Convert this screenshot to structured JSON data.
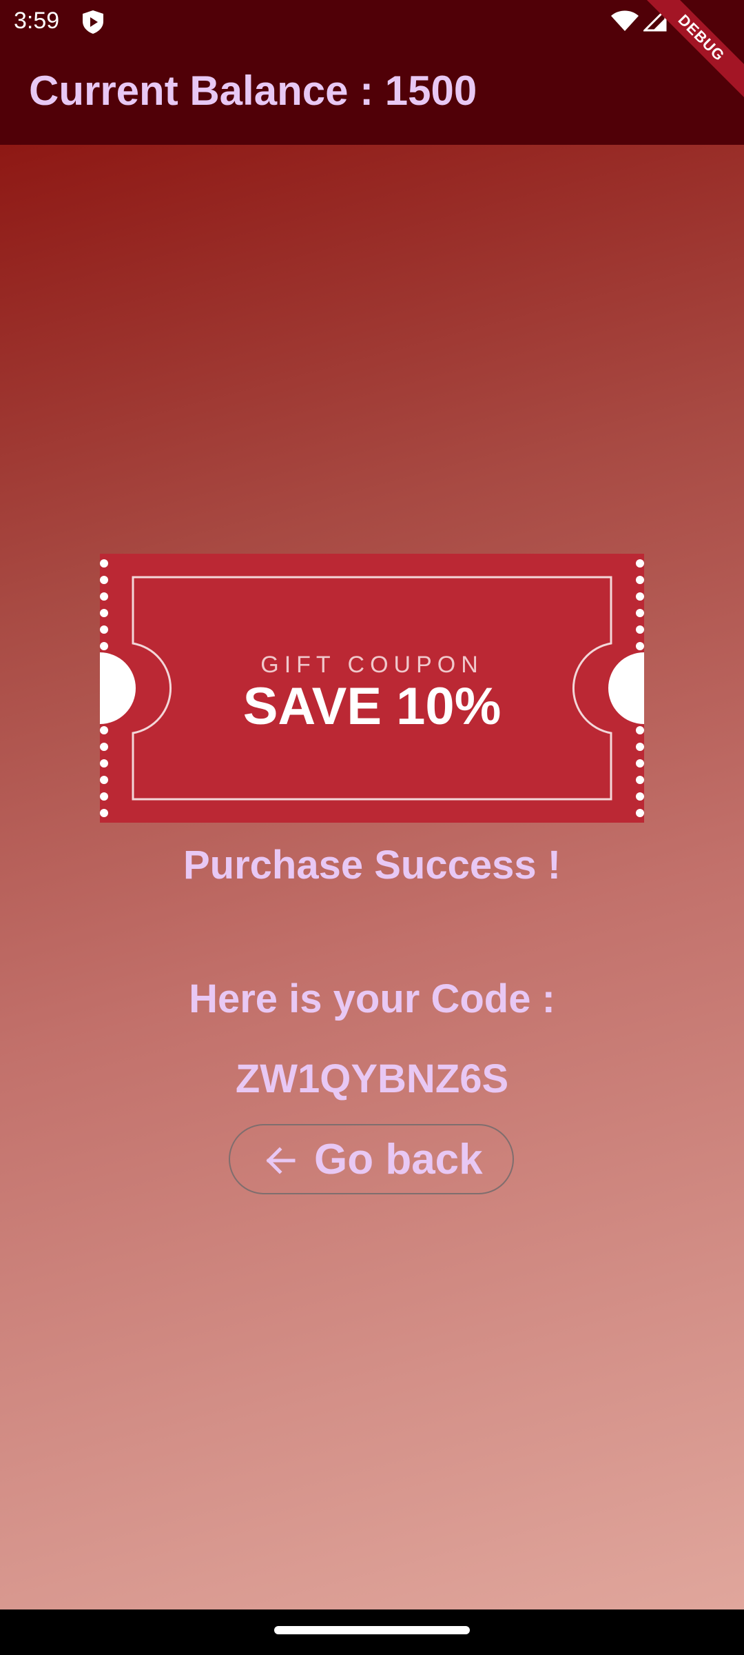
{
  "status_bar": {
    "time": "3:59",
    "icons": [
      "shield-icon",
      "wifi-icon",
      "cell-signal-icon"
    ]
  },
  "debug_banner": {
    "label": "DEBUG"
  },
  "app_bar": {
    "title": "Current Balance : 1500"
  },
  "coupon": {
    "heading": "GIFT COUPON",
    "offer": "SAVE 10%"
  },
  "result": {
    "success_message": "Purchase Success !",
    "code_label": "Here is your Code :",
    "code": "ZW1QYBNZ6S"
  },
  "go_back": {
    "label": "Go back",
    "icon": "arrow-back-icon"
  },
  "colors": {
    "app_bar": "#500007",
    "text_accent": "#e8c8f4",
    "coupon_red": "#bb2834",
    "gradient_top": "#8e1814",
    "gradient_bottom": "#e0a69c"
  }
}
